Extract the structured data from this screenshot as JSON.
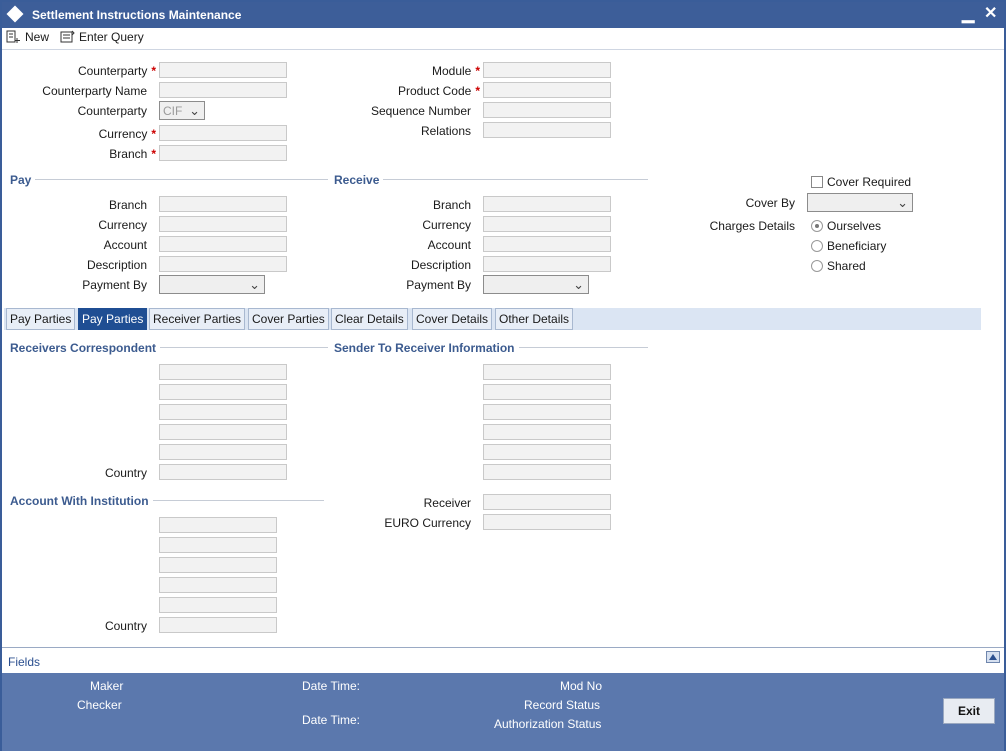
{
  "window": {
    "title": "Settlement Instructions Maintenance"
  },
  "toolbar": {
    "new_label": "New",
    "enter_query_label": "Enter Query"
  },
  "header": {
    "counterparty_label": "Counterparty",
    "counterparty_name_label": "Counterparty Name",
    "counterparty_type_label": "Counterparty",
    "counterparty_type_value": "CIF",
    "currency_label": "Currency",
    "branch_label": "Branch",
    "module_label": "Module",
    "product_code_label": "Product Code",
    "sequence_number_label": "Sequence Number",
    "relations_label": "Relations",
    "required_marker": "*"
  },
  "pay": {
    "title": "Pay",
    "branch_label": "Branch",
    "currency_label": "Currency",
    "account_label": "Account",
    "description_label": "Description",
    "payment_by_label": "Payment By"
  },
  "receive": {
    "title": "Receive",
    "branch_label": "Branch",
    "currency_label": "Currency",
    "account_label": "Account",
    "description_label": "Description",
    "payment_by_label": "Payment By"
  },
  "cover": {
    "cover_required_label": "Cover Required",
    "cover_by_label": "Cover By",
    "charges_details_label": "Charges Details",
    "options": [
      "Ourselves",
      "Beneficiary",
      "Shared"
    ],
    "selected": "Ourselves"
  },
  "tabs": [
    {
      "label": "Pay Parties",
      "active": false
    },
    {
      "label": "Pay Parties",
      "active": true
    },
    {
      "label": "Receiver Parties",
      "active": false
    },
    {
      "label": "Cover Parties",
      "active": false
    },
    {
      "label": "Clear Details",
      "active": false
    },
    {
      "label": "Cover Details",
      "active": false
    },
    {
      "label": "Other Details",
      "active": false
    }
  ],
  "tab_body": {
    "receivers_correspondent_title": "Receivers Correspondent",
    "sender_to_receiver_title": "Sender To Receiver Information",
    "country_label": "Country",
    "account_with_institution_title": "Account With Institution",
    "receiver_label": "Receiver",
    "euro_currency_label": "EURO Currency",
    "country2_label": "Country"
  },
  "fields_bar": {
    "label": "Fields"
  },
  "footer": {
    "maker_label": "Maker",
    "checker_label": "Checker",
    "date_time_label_1": "Date Time:",
    "date_time_label_2": "Date Time:",
    "mod_no_label": "Mod No",
    "record_status_label": "Record Status",
    "authorization_status_label": "Authorization Status",
    "exit_label": "Exit"
  },
  "colors": {
    "title_bar": "#3d5e99",
    "footer": "#5b78ad",
    "active_tab": "#1f4e93",
    "required": "#cc0000",
    "section_title": "#3c5b8f"
  }
}
